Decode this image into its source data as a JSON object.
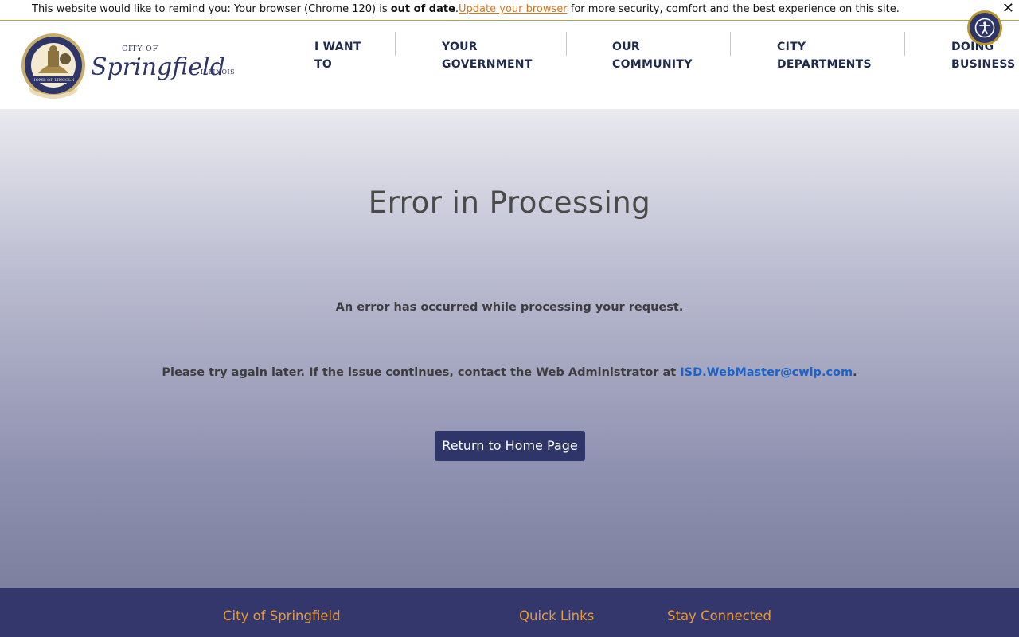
{
  "notice": {
    "prefix": "This website would like to remind you: Your browser (Chrome 120) is ",
    "bold": "out of date",
    "period": ".",
    "link": "Update your browser",
    "suffix": " for more security, comfort and the best experience on this site.",
    "close": "✕"
  },
  "brand": {
    "city_of": "CITY OF",
    "name": "Springfield",
    "state": "ILLINOIS",
    "seal_ring_text": "CITY OF SPRINGFIELD CAPITAL OF ILLINOIS",
    "seal_banner": "HOME OF LINCOLN",
    "seal_year": "1840"
  },
  "nav": {
    "items": [
      {
        "label": "I WANT TO"
      },
      {
        "label": "YOUR GOVERNMENT"
      },
      {
        "label": "OUR COMMUNITY"
      },
      {
        "label": "CITY DEPARTMENTS"
      },
      {
        "label": "DOING BUSINESS"
      }
    ]
  },
  "error": {
    "title": "Error in Processing",
    "message": "An error has occurred while processing your request.",
    "contact_prefix": "Please try again later. If the issue continues, contact the Web Administrator at ",
    "contact_email": "ISD.WebMaster@cwlp.com",
    "contact_suffix": ".",
    "button": "Return to Home Page"
  },
  "footer": {
    "headings": [
      "City of Springfield",
      "Quick Links",
      "Stay Connected"
    ]
  },
  "colors": {
    "navy": "#2e3568",
    "footer_bg": "#33376b",
    "footer_heading": "#e89a3c",
    "link_blue": "#1d62c7",
    "notice_link": "#d9741c",
    "gold": "#b8962e"
  },
  "icons": {
    "accessibility": "accessibility-icon",
    "close": "close-icon",
    "seal": "city-seal-icon"
  }
}
